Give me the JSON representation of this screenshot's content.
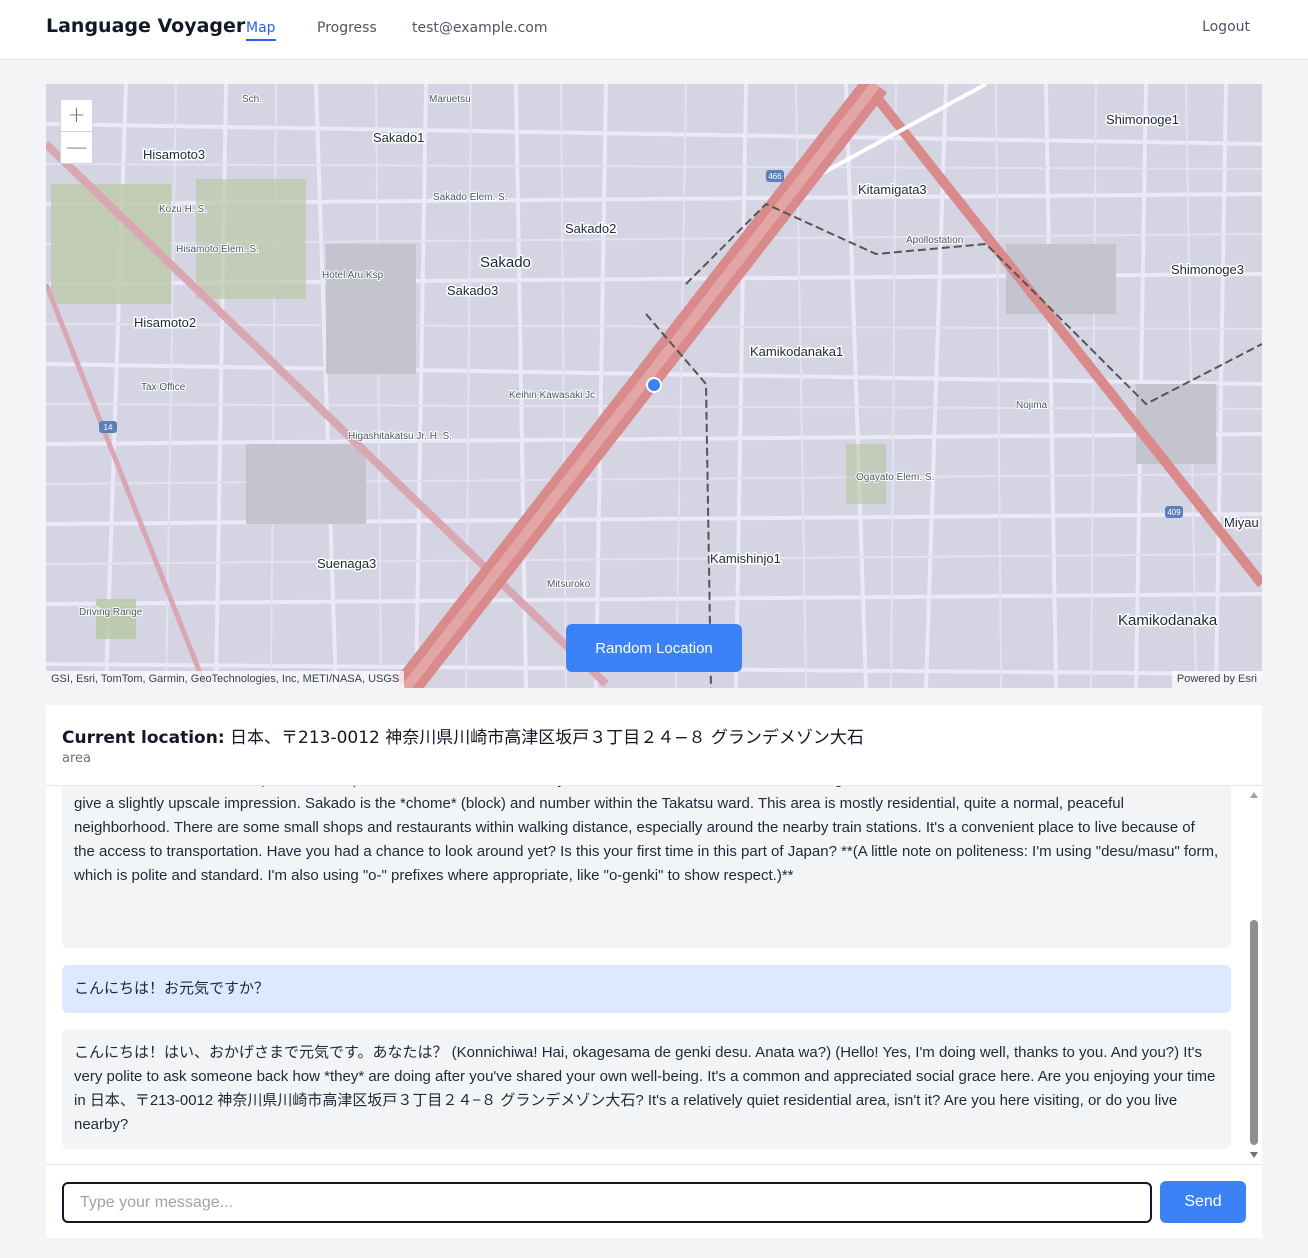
{
  "app": {
    "brand": "Language Voyager",
    "nav": {
      "map": "Map",
      "progress": "Progress",
      "email": "test@example.com",
      "logout": "Logout"
    }
  },
  "map": {
    "zoom_in": "+",
    "zoom_out": "—",
    "random_button": "Random Location",
    "attribution": "GSI, Esri, TomTom, Garmin, GeoTechnologies, Inc, METI/NASA, USGS",
    "powered_by": "Powered by Esri",
    "labels": {
      "hisamoto3": "Hisamoto3",
      "hisamoto2": "Hisamoto2",
      "sakado1": "Sakado1",
      "sakado2": "Sakado2",
      "sakado": "Sakado",
      "sakado3": "Sakado3",
      "kitamigata3": "Kitamigata3",
      "shimonoge1": "Shimonoge1",
      "shimonoge3": "Shimonoge3",
      "kamikodanaka1": "Kamikodanaka1",
      "kamikodanaka": "Kamikodanaka",
      "kamishinjo1": "Kamishinjo1",
      "suenaga3": "Suenaga3",
      "miyau": "Miyau",
      "hotel": "Hotel Aru Ksp",
      "tax_office": "Tax Office",
      "apollostation": "Apollostation",
      "nojima": "Nojima",
      "mitsuroko": "Mitsuroko",
      "driving_range": "Driving Range",
      "kozu": "Kozu H. S.",
      "hisamoto_elem": "Hisamoto Elem. S.",
      "sakado_elem": "Sakado Elem. S.",
      "keihin": "Keihin Kawasaki Jc",
      "higashitakatsu": "Higashitakatsu Jr. H. S.",
      "ogayato": "Ogayato Elem. S.",
      "maruetsu": "Maruetsu",
      "sch": "Sch.",
      "route_466": "466",
      "route_14": "14",
      "route_409": "409"
    }
  },
  "location": {
    "label": "Current location:",
    "address": "日本、〒213-0012 神奈川県川崎市高津区坂戸３丁目２４−８ グランデメゾン大石",
    "type": "area"
  },
  "chat": {
    "messages": [
      {
        "role": "assistant",
        "text": "Maison Oishi,\" which is an apartment complex. \"Grande Maison\" is a fairly common name for these kinds of buildings – it means \"Grand House\" in French, and is used to give a slightly upscale impression. Sakado is the *chome* (block) and number within the Takatsu ward. This area is mostly residential, quite a normal, peaceful neighborhood. There are some small shops and restaurants within walking distance, especially around the nearby train stations. It's a convenient place to live because of the access to transportation. Have you had a chance to look around yet? Is this your first time in this part of Japan? **(A little note on politeness: I'm using \"desu/masu\" form, which is polite and standard. I'm also using \"o-\" prefixes where appropriate, like \"o-genki\" to show respect.)**"
      },
      {
        "role": "user",
        "text": "こんにちは！お元気ですか？"
      },
      {
        "role": "assistant",
        "text": "こんにちは！はい、おかげさまで元気です。あなたは？ (Konnichiwa! Hai, okagesama de genki desu. Anata wa?) (Hello! Yes, I'm doing well, thanks to you. And you?) It's very polite to ask someone back how *they* are doing after you've shared your own well-being. It's a common and appreciated social grace here. Are you enjoying your time in 日本、〒213-0012 神奈川県川崎市高津区坂戸３丁目２４−８ グランデメゾン大石? It's a relatively quiet residential area, isn't it? Are you here visiting, or do you live nearby?"
      }
    ]
  },
  "composer": {
    "placeholder": "Type your message...",
    "send": "Send"
  },
  "colors": {
    "accent": "#3b82f6",
    "map_bg": "#d4d4e2",
    "highway": "#d98a8a",
    "user_bubble": "#dbeafe",
    "ai_bubble": "#f3f4f6"
  }
}
